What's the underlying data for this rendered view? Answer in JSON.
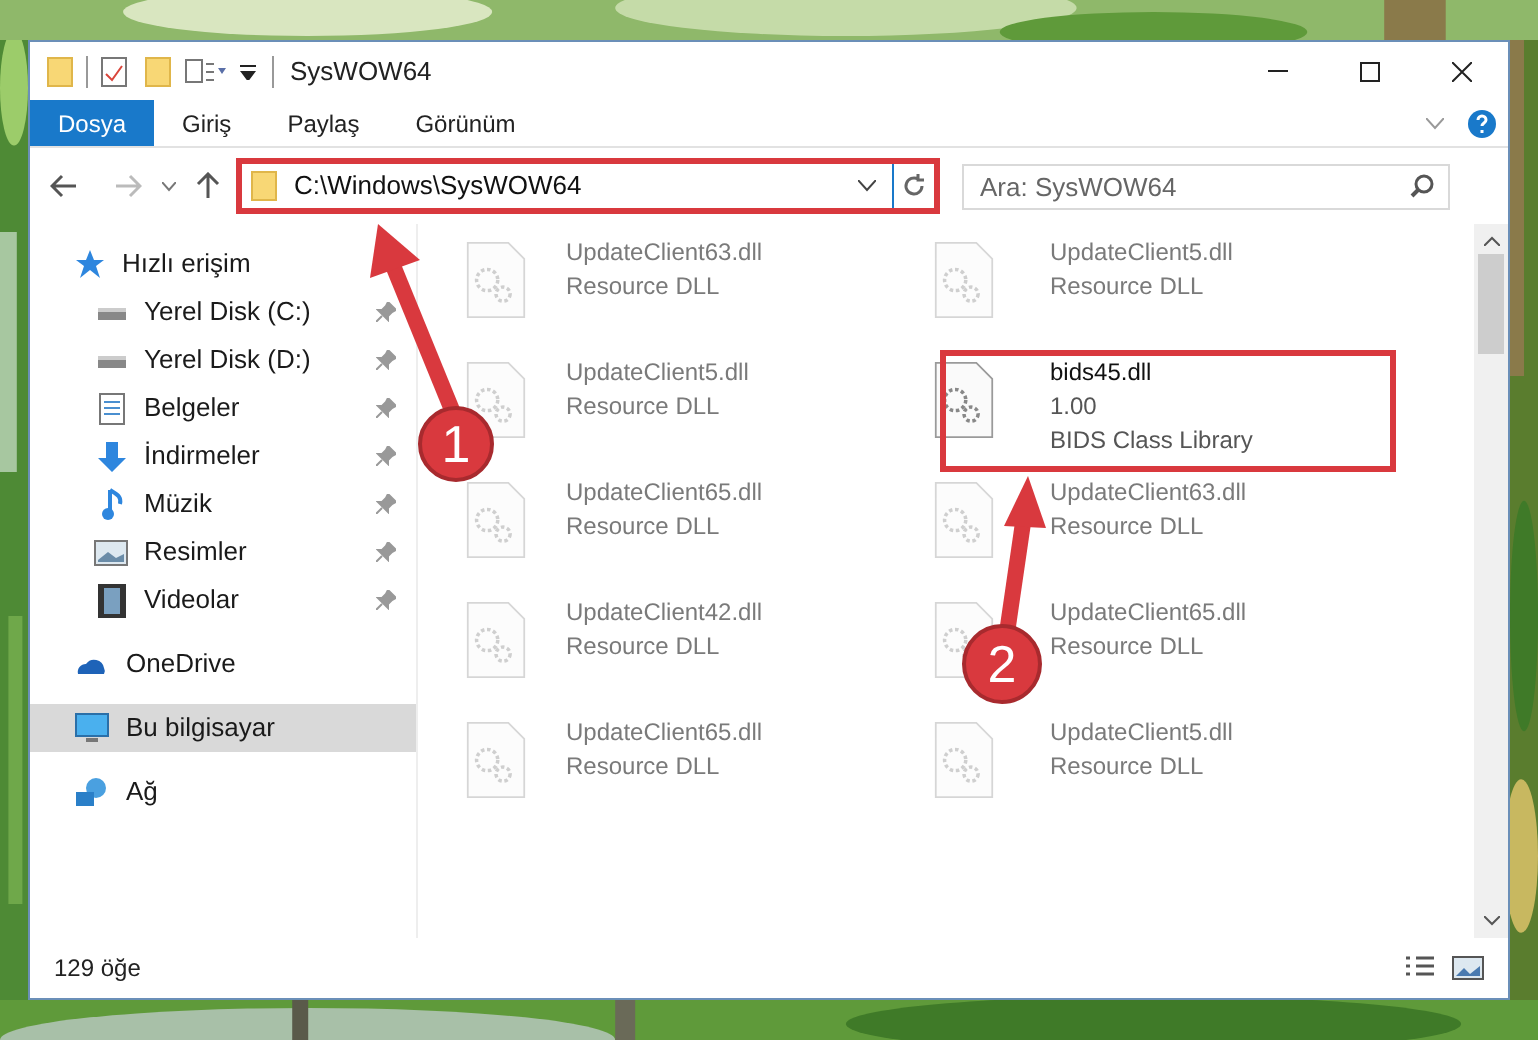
{
  "window": {
    "title": "SysWOW64"
  },
  "ribbon": {
    "tabs": [
      {
        "label": "Dosya",
        "selected": true
      },
      {
        "label": "Giriş",
        "selected": false
      },
      {
        "label": "Paylaş",
        "selected": false
      },
      {
        "label": "Görünüm",
        "selected": false
      }
    ]
  },
  "address_bar": {
    "path": "C:\\Windows\\SysWOW64"
  },
  "search": {
    "placeholder": "Ara: SysWOW64"
  },
  "sidebar": {
    "items": [
      {
        "label": "Hızlı erişim",
        "selected": false,
        "children": [
          {
            "label": "Yerel Disk (C:)",
            "pinned": true,
            "selected": false
          },
          {
            "label": "Yerel Disk (D:)",
            "pinned": true,
            "selected": false
          },
          {
            "label": "Belgeler",
            "pinned": true,
            "selected": false
          },
          {
            "label": "İndirmeler",
            "pinned": true,
            "selected": false
          },
          {
            "label": "Müzik",
            "pinned": true,
            "selected": false
          },
          {
            "label": "Resimler",
            "pinned": true,
            "selected": false
          },
          {
            "label": "Videolar",
            "pinned": true,
            "selected": false
          }
        ]
      },
      {
        "label": "OneDrive",
        "selected": false
      },
      {
        "label": "Bu bilgisayar",
        "selected": true
      },
      {
        "label": "Ağ",
        "selected": false
      }
    ]
  },
  "files": [
    {
      "name": "UpdateClient63.dll",
      "lines": [
        "Resource DLL"
      ],
      "kind": "faded"
    },
    {
      "name": "UpdateClient5.dll",
      "lines": [
        "Resource DLL"
      ],
      "kind": "faded"
    },
    {
      "name": "UpdateClient5.dll",
      "lines": [
        "Resource DLL"
      ],
      "kind": "faded"
    },
    {
      "name": "bids45.dll",
      "lines": [
        "1.00",
        "BIDS Class Library"
      ],
      "kind": "clear"
    },
    {
      "name": "UpdateClient65.dll",
      "lines": [
        "Resource DLL"
      ],
      "kind": "faded"
    },
    {
      "name": "UpdateClient63.dll",
      "lines": [
        "Resource DLL"
      ],
      "kind": "faded"
    },
    {
      "name": "UpdateClient42.dll",
      "lines": [
        "Resource DLL"
      ],
      "kind": "faded"
    },
    {
      "name": "UpdateClient65.dll",
      "lines": [
        "Resource DLL"
      ],
      "kind": "faded"
    },
    {
      "name": "UpdateClient65.dll",
      "lines": [
        "Resource DLL"
      ],
      "kind": "faded"
    },
    {
      "name": "UpdateClient5.dll",
      "lines": [
        "Resource DLL"
      ],
      "kind": "faded"
    }
  ],
  "status_bar": {
    "count": "129 öğe"
  },
  "annotations": [
    {
      "label": "1"
    },
    {
      "label": "2"
    }
  ]
}
